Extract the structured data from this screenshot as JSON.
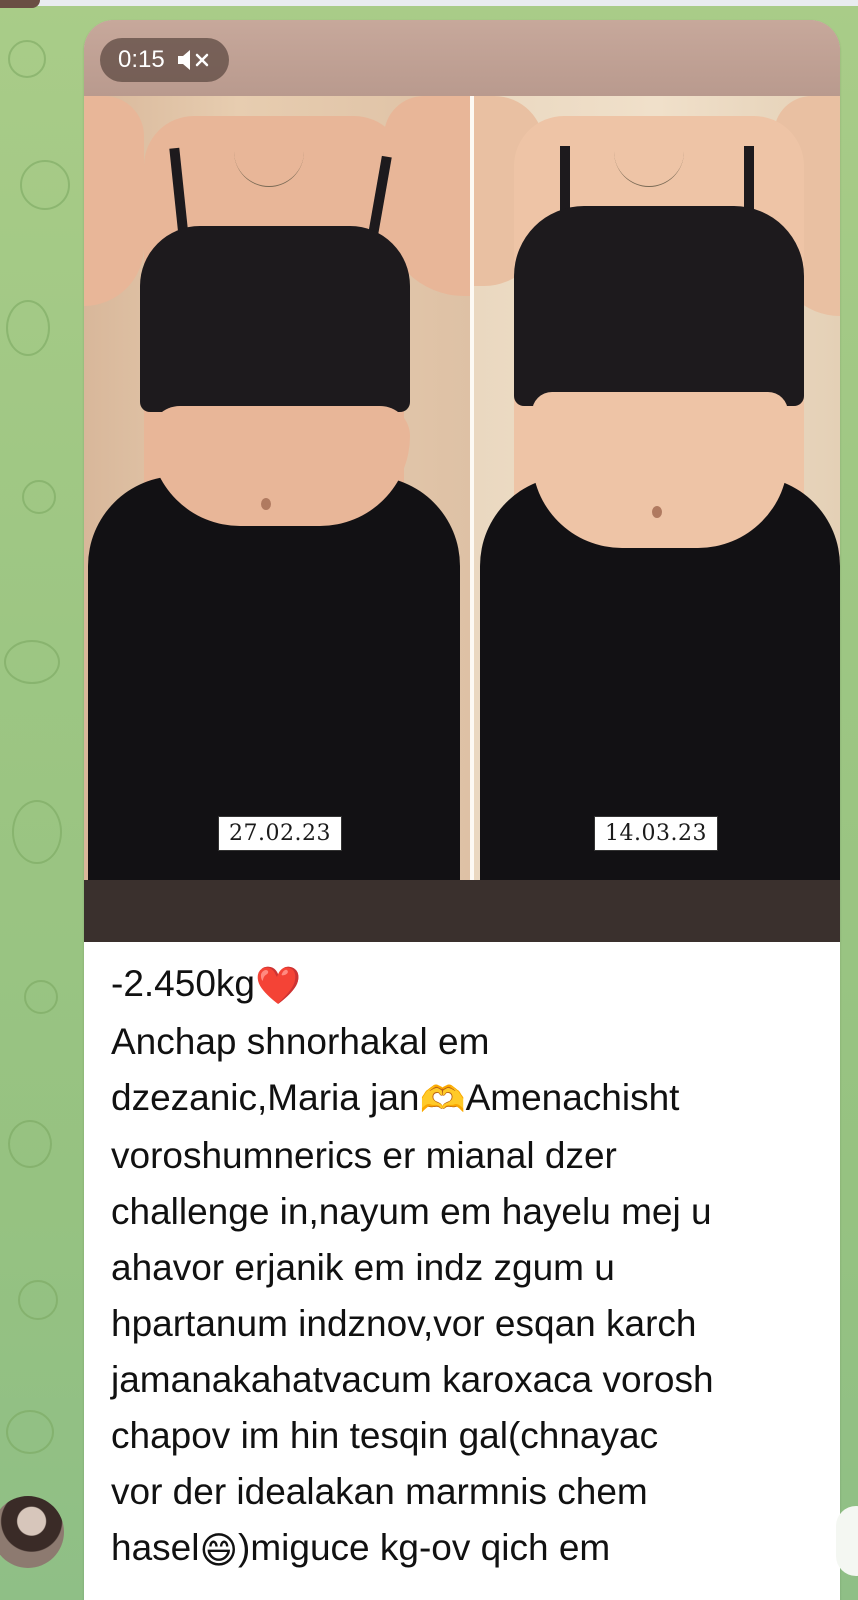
{
  "video": {
    "duration": "0:15",
    "mute_icon": "speaker-muted-icon",
    "before_date": "27.02.23",
    "after_date": "14.03.23"
  },
  "caption": {
    "lines": [
      "-2.450kg",
      "Anchap shnorhakal em",
      "dzezanic,Maria jan",
      "Amenachisht",
      "voroshumnerics er mianal dzer",
      "challenge in,nayum em hayelu mej u",
      "ahavor erjanik em indz zgum u",
      "hpartanum indznov,vor esqan karch",
      "jamanakahatvacum karoxaca vorosh",
      "chapov im hin tesqin gal(chnayac",
      "vor der idealakan marmnis chem",
      "hasel",
      ")miguce kg-ov qich em"
    ],
    "emojis": {
      "heart": "❤️",
      "heart_hands": "🫶",
      "grin": "😄"
    }
  },
  "colors": {
    "chat_background": "#9dc683",
    "bubble": "#ffffff",
    "text": "#111111"
  }
}
